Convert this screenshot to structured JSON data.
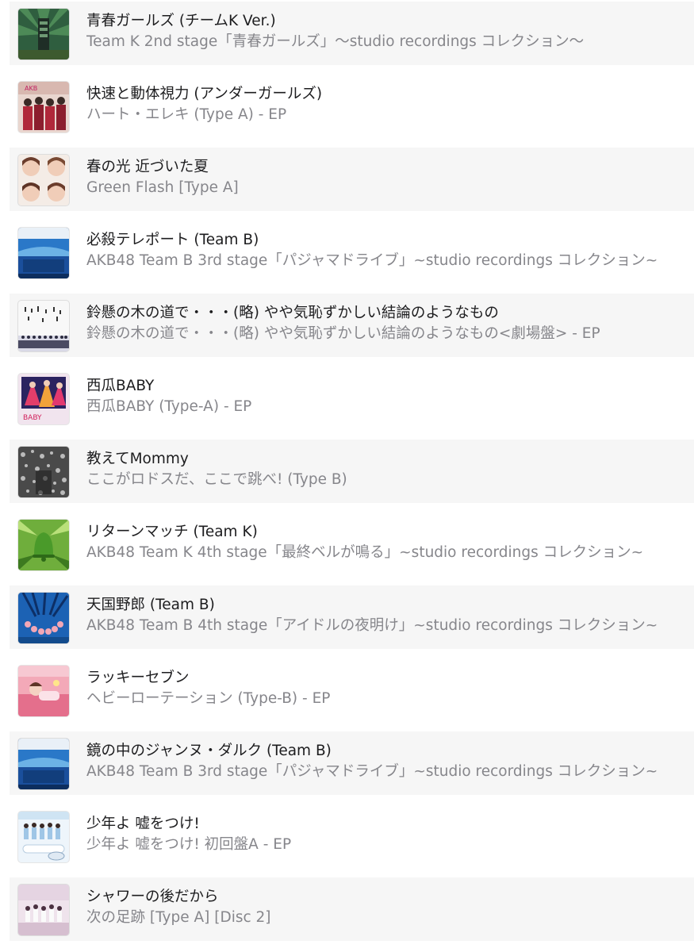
{
  "tracks": [
    {
      "title": "青春ガールズ (チームK Ver.)",
      "album": "Team K 2nd stage「青春ガールズ」〜studio recordings コレクション〜",
      "art_icon": "album-art-tower"
    },
    {
      "title": "快速と動体視力 (アンダーガールズ)",
      "album": "ハート・エレキ (Type A) - EP",
      "art_icon": "album-art-group-red"
    },
    {
      "title": "春の光 近づいた夏",
      "album": "Green Flash [Type A]",
      "art_icon": "album-art-four-faces"
    },
    {
      "title": "必殺テレポート (Team B)",
      "album": "AKB48 Team B 3rd stage「パジャマドライブ」~studio recordings コレクション~",
      "art_icon": "album-art-blue-stage"
    },
    {
      "title": "鈴懸の木の道で・・・(略) やや気恥ずかしい結論のようなもの",
      "album": "鈴懸の木の道で・・・(略) やや気恥ずかしい結論のようなもの<劇場盤> - EP",
      "art_icon": "album-art-white-group"
    },
    {
      "title": "西瓜BABY",
      "album": "西瓜BABY (Type-A) - EP",
      "art_icon": "album-art-watermelon"
    },
    {
      "title": "教えてMommy",
      "album": "ここがロドスだ、ここで跳べ! (Type B)",
      "art_icon": "album-art-mono-crowd"
    },
    {
      "title": "リターンマッチ (Team K)",
      "album": "AKB48 Team K 4th stage「最終ベルが鳴る」~studio recordings コレクション~",
      "art_icon": "album-art-green-bell"
    },
    {
      "title": "天国野郎 (Team B)",
      "album": "AKB48 Team B 4th stage「アイドルの夜明け」~studio recordings コレクション~",
      "art_icon": "album-art-blue-ring"
    },
    {
      "title": "ラッキーセブン",
      "album": "ヘビーローテーション (Type-B) - EP",
      "art_icon": "album-art-pink-bed"
    },
    {
      "title": "鏡の中のジャンヌ・ダルク (Team B)",
      "album": "AKB48 Team B 3rd stage「パジャマドライブ」~studio recordings コレクション~",
      "art_icon": "album-art-blue-stage"
    },
    {
      "title": "少年よ 嘘をつけ!",
      "album": "少年よ 嘘をつけ! 初回盤A - EP",
      "art_icon": "album-art-light-group"
    },
    {
      "title": "シャワーの後だから",
      "album": "次の足跡 [Type A] [Disc 2]",
      "art_icon": "album-art-pink-group"
    }
  ]
}
